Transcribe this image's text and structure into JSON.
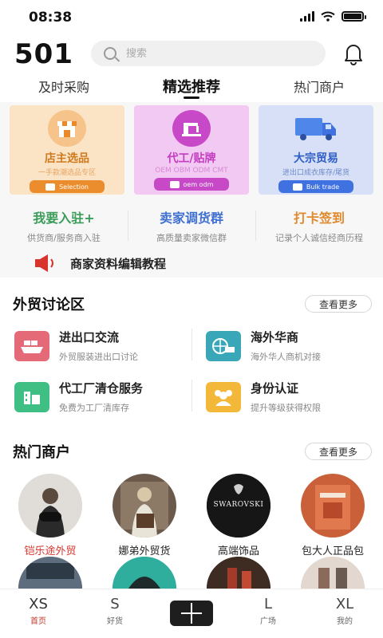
{
  "status_bar": {
    "time": "08:38"
  },
  "header": {
    "logo": "501",
    "search_placeholder": "搜索"
  },
  "tabs": [
    {
      "label": "及时采购",
      "active": false
    },
    {
      "label": "精选推荐",
      "active": true
    },
    {
      "label": "热门商户",
      "active": false
    }
  ],
  "cards": [
    {
      "title": "店主选品",
      "subtitle": "一手款潮选品专区",
      "button": "Selection",
      "icon": "shop-icon",
      "accent": "#eb8d2c"
    },
    {
      "title": "代工/贴牌",
      "subtitle": "OEM OBM ODM CMT",
      "button": "oem odm",
      "icon": "sewing-machine-icon",
      "accent": "#c849c8"
    },
    {
      "title": "大宗贸易",
      "subtitle": "进出口成衣库存/尾货",
      "button": "Bulk trade",
      "icon": "truck-icon",
      "accent": "#3f72e0"
    }
  ],
  "actions": [
    {
      "title": "我要入驻+",
      "subtitle": "供货商/服务商入驻",
      "color": "#3c9d5a"
    },
    {
      "title": "卖家调货群",
      "subtitle": "高质量卖家微信群",
      "color": "#3f6fd0"
    },
    {
      "title": "打卡签到",
      "subtitle": "记录个人诚信经商历程",
      "color": "#e08a2e"
    }
  ],
  "tutorial": {
    "label": "商家资料编辑教程",
    "icon": "speaker-icon"
  },
  "forum": {
    "title": "外贸讨论区",
    "more": "查看更多",
    "items": [
      {
        "title": "进出口交流",
        "subtitle": "外贸服装进出口讨论",
        "icon": "ship-icon",
        "color": "#e05a6a"
      },
      {
        "title": "海外华商",
        "subtitle": "海外华人商机对接",
        "icon": "globe-truck-icon",
        "color": "#3aa7b8"
      },
      {
        "title": "代工厂清仓服务",
        "subtitle": "免费为工厂清库存",
        "icon": "factory-icon",
        "color": "#37b07a"
      },
      {
        "title": "身份认证",
        "subtitle": "提升等级获得权限",
        "icon": "people-icon",
        "color": "#f0b429"
      }
    ]
  },
  "merchants": {
    "title": "热门商户",
    "more": "查看更多",
    "items": [
      {
        "name": "铠乐途外贸",
        "highlight": true
      },
      {
        "name": "娜弟外贸货",
        "highlight": false
      },
      {
        "name": "高端饰品",
        "highlight": false,
        "logo_text": "SWAROVSKI"
      },
      {
        "name": "包大人正品包",
        "highlight": false
      }
    ]
  },
  "tabbar": [
    {
      "glyph": "XS",
      "label": "首页",
      "active": true
    },
    {
      "glyph": "S",
      "label": "好货",
      "active": false
    },
    {
      "glyph": "",
      "label": "",
      "active": false,
      "plus": true
    },
    {
      "glyph": "L",
      "label": "广场",
      "active": false
    },
    {
      "glyph": "XL",
      "label": "我的",
      "active": false
    }
  ]
}
